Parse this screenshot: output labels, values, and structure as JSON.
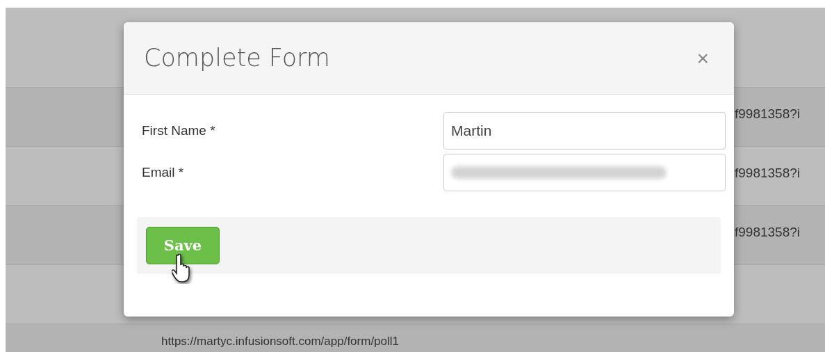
{
  "background_rows": [
    {
      "tail": "f9981358?i"
    },
    {
      "tail": "f9981358?i"
    },
    {
      "tail": "f9981358?i"
    },
    {},
    {
      "url": "https://martyc.infusionsoft.com/app/form/poll1"
    }
  ],
  "dialog": {
    "title": "Complete Form",
    "close": "×",
    "fields": [
      {
        "label": "First Name *",
        "value": "Martin",
        "blurred": false
      },
      {
        "label": "Email *",
        "blurred": true
      }
    ],
    "save_button": "Save"
  }
}
